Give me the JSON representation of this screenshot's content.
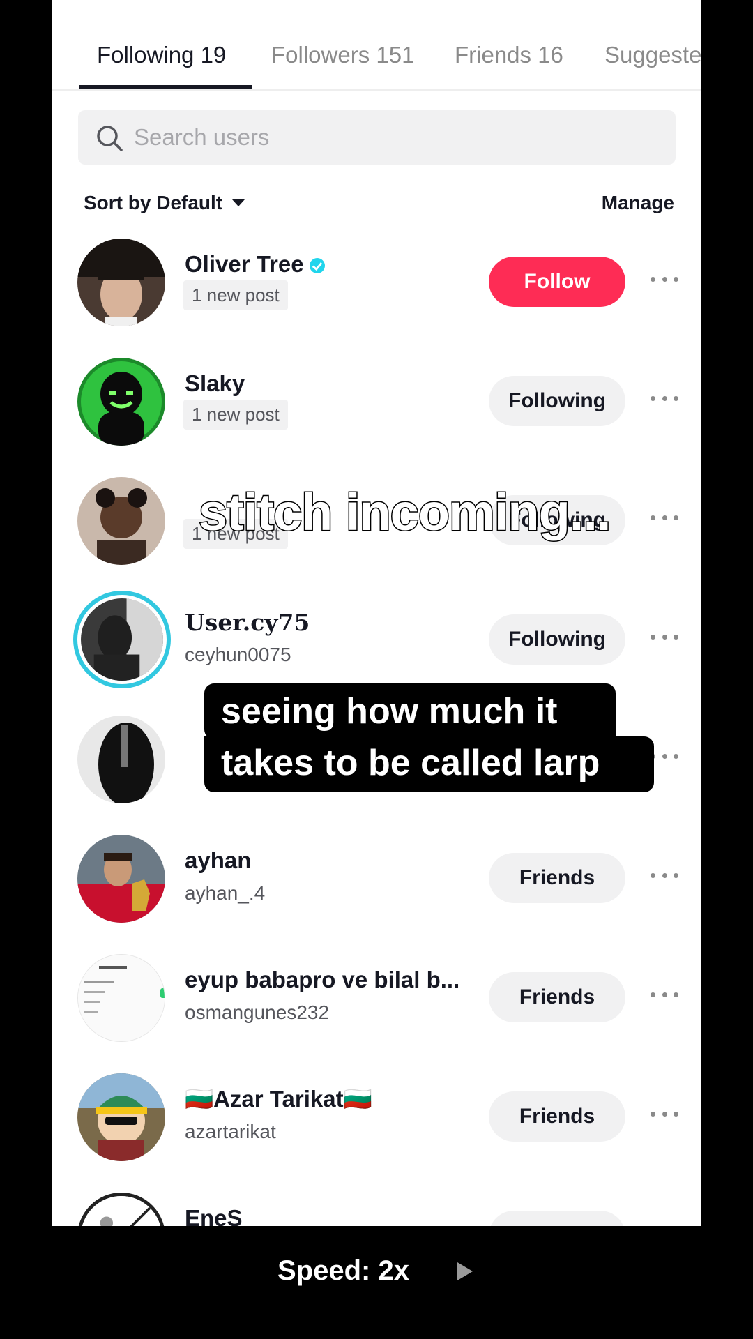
{
  "tabs": [
    {
      "label": "Following 19",
      "active": true
    },
    {
      "label": "Followers 151",
      "active": false
    },
    {
      "label": "Friends 16",
      "active": false
    },
    {
      "label": "Suggeste",
      "active": false
    }
  ],
  "search": {
    "placeholder": "Search users"
  },
  "sort": {
    "label": "Sort by Default"
  },
  "manage_label": "Manage",
  "users": [
    {
      "name": "Oliver Tree",
      "sub": "1 new post",
      "button": "Follow"
    },
    {
      "name": "Slaky",
      "sub": "1 new post",
      "button": "Following"
    },
    {
      "name": "",
      "sub": "1 new post",
      "button": "Following"
    },
    {
      "name": "User.cy75",
      "sub": "ceyhun0075",
      "button": "Following"
    },
    {
      "name": "",
      "sub": "",
      "button": ""
    },
    {
      "name": "ayhan",
      "sub": "ayhan_.4",
      "button": "Friends"
    },
    {
      "name": "eyup babapro ve bilal b...",
      "sub": "osmangunes232",
      "button": "Friends"
    },
    {
      "name": "🇧🇬Azar Tarikat🇧🇬",
      "sub": "azartarikat",
      "button": "Friends"
    },
    {
      "name": "EneS",
      "sub": "",
      "button": ""
    }
  ],
  "captions": {
    "top": "stitch incoming...",
    "line1": "seeing how much it",
    "line2": "takes to be called larp"
  },
  "speed_label": "Speed: 2x",
  "colors": {
    "accent": "#fe2c55",
    "verified": "#20d5ec"
  }
}
